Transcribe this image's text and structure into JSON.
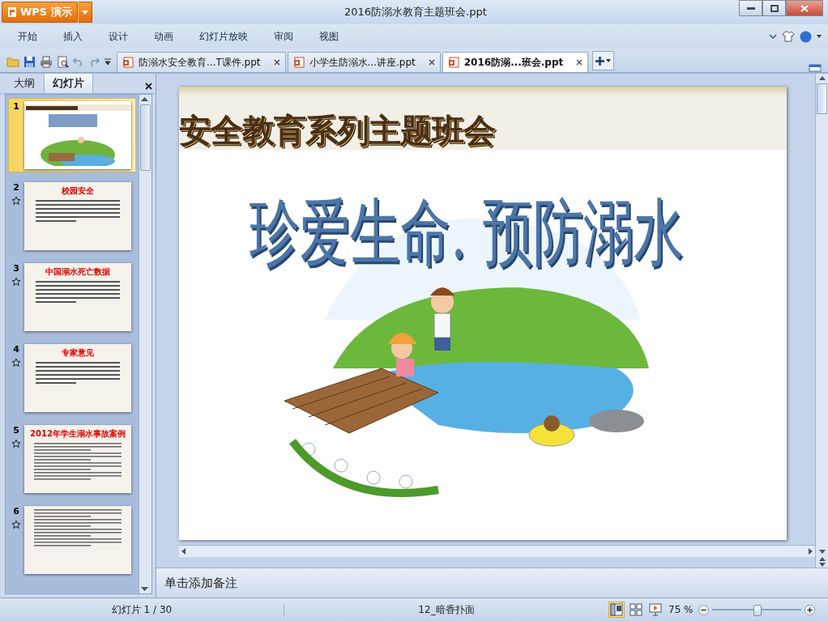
{
  "app": {
    "logo": "WPS 演示",
    "title": "2016防溺水教育主题班会.ppt"
  },
  "menu": [
    "开始",
    "插入",
    "设计",
    "动画",
    "幻灯片放映",
    "审阅",
    "视图"
  ],
  "documents": [
    {
      "label": "防溺水安全教育...T课件.ppt",
      "selected": false
    },
    {
      "label": "小学生防溺水...讲座.ppt",
      "selected": false
    },
    {
      "label": "2016防溺...班会.ppt",
      "selected": true
    }
  ],
  "panel_tabs": [
    {
      "label": "大纲",
      "selected": false
    },
    {
      "label": "幻灯片",
      "selected": true
    }
  ],
  "thumbnails": [
    {
      "number": "1",
      "kind": "cover",
      "selected": true,
      "animated": false
    },
    {
      "number": "2",
      "kind": "text",
      "title": "校园安全",
      "selected": false,
      "animated": true
    },
    {
      "number": "3",
      "kind": "text",
      "title": "中国溺水死亡数据",
      "selected": false,
      "animated": true
    },
    {
      "number": "4",
      "kind": "text",
      "title": "专家意见",
      "selected": false,
      "animated": true
    },
    {
      "number": "5",
      "kind": "dense",
      "title": "2012年学生溺水事故案例",
      "selected": false,
      "animated": true
    },
    {
      "number": "6",
      "kind": "dense",
      "selected": false,
      "animated": true
    }
  ],
  "slide": {
    "title": "安全教育系列主题班会",
    "headline": "珍爱生命. 预防溺水"
  },
  "notes": {
    "placeholder": "单击添加备注"
  },
  "status": {
    "slide_counter": "幻灯片 1 / 30",
    "theme": "12_暗香扑面",
    "zoom": "75 %",
    "zoom_level": {
      "level": 0.5
    },
    "view_modes": [
      {
        "kind": "normal",
        "selected": true
      },
      {
        "kind": "sorter",
        "selected": false
      },
      {
        "kind": "show",
        "selected": false
      }
    ]
  }
}
